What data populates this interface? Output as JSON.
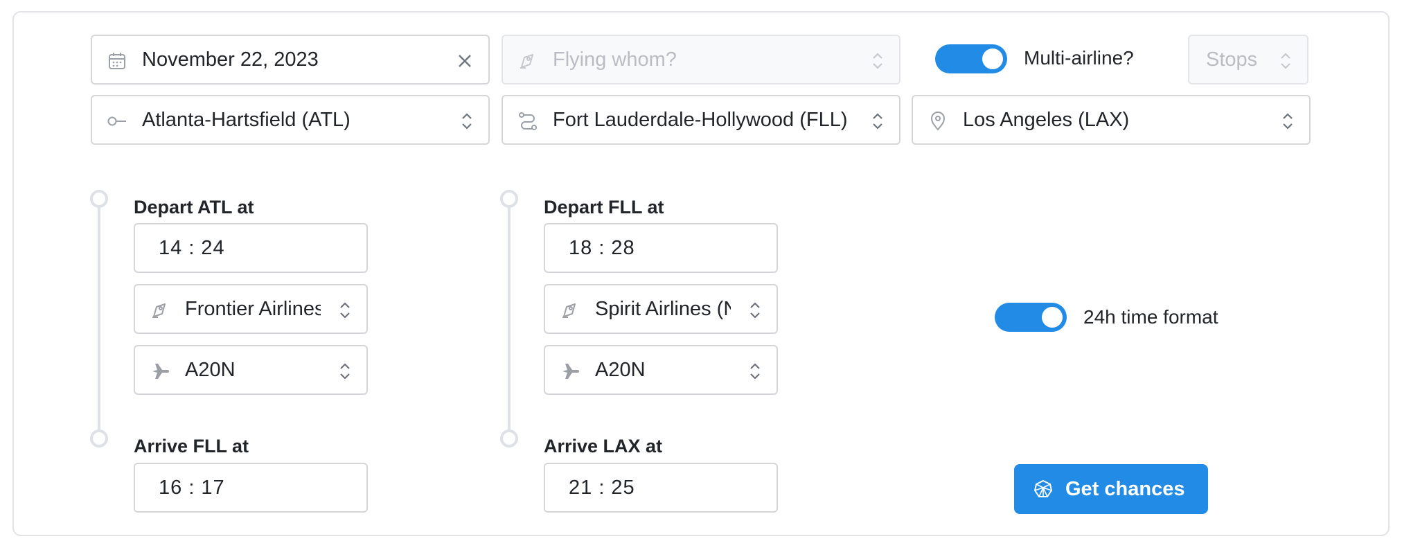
{
  "search": {
    "date": {
      "value": "November 22, 2023",
      "icon": "calendar-icon"
    },
    "operator": {
      "placeholder": "Flying whom?",
      "icon": "plane-tag-icon"
    },
    "multi_airline": {
      "label": "Multi-airline?",
      "checked": true
    },
    "stops": {
      "placeholder": "Stops"
    },
    "origin": {
      "value": "Atlanta-Hartsfield (ATL)",
      "icon": "origin-icon"
    },
    "via": {
      "value": "Fort Lauderdale-Hollywood (FLL)",
      "icon": "route-icon"
    },
    "destination": {
      "value": "Los Angeles (LAX)",
      "icon": "map-pin-icon"
    }
  },
  "legs": [
    {
      "depart_label": "Depart ATL at",
      "depart_time": "14 : 24",
      "airline": "Frontier Airlines",
      "aircraft": "A20N",
      "arrive_label": "Arrive FLL at",
      "arrive_time": "16 : 17"
    },
    {
      "depart_label": "Depart FLL at",
      "depart_time": "18 : 28",
      "airline": "Spirit Airlines (NK)",
      "aircraft": "A20N",
      "arrive_label": "Arrive LAX at",
      "arrive_time": "21 : 25"
    }
  ],
  "settings": {
    "time_format_label": "24h time format",
    "time_format_24h": true
  },
  "action": {
    "label": "Get chances",
    "icon": "brain-icon"
  },
  "colors": {
    "accent": "#228be6",
    "border": "#d4d6da",
    "placeholder": "#b9bdc3"
  }
}
